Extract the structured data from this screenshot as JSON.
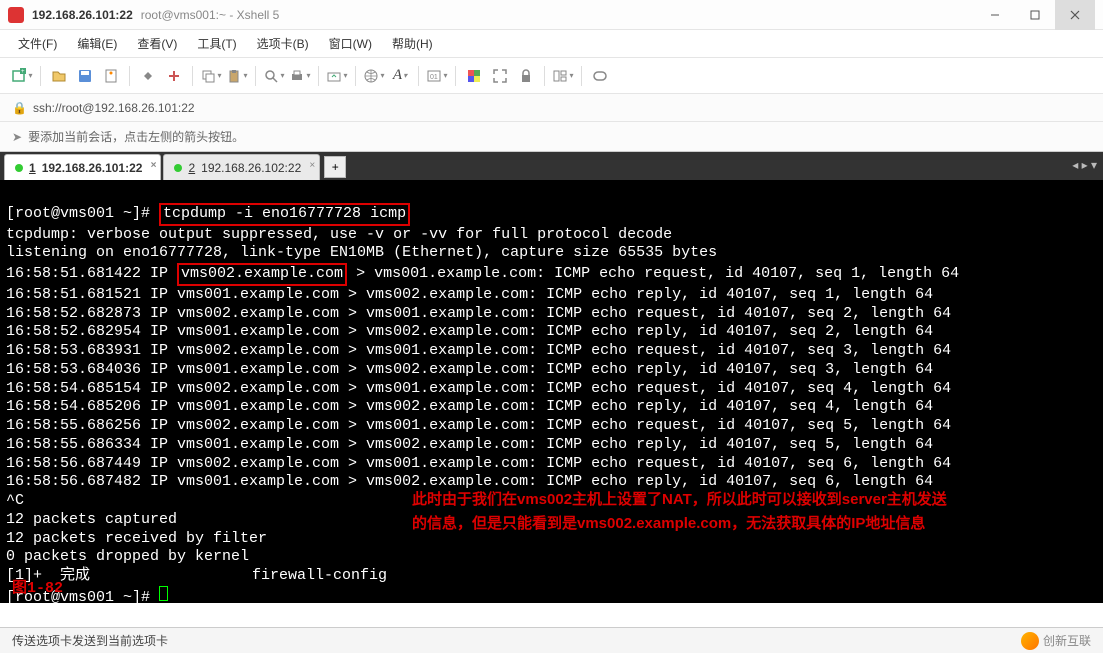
{
  "window": {
    "title_main": "192.168.26.101:22",
    "title_sub": "root@vms001:~ - Xshell 5"
  },
  "menubar": {
    "file": "文件(F)",
    "edit": "编辑(E)",
    "view": "查看(V)",
    "tools": "工具(T)",
    "tabs": "选项卡(B)",
    "window": "窗口(W)",
    "help": "帮助(H)"
  },
  "address": {
    "url": "ssh://root@192.168.26.101:22"
  },
  "infobar": {
    "text": "要添加当前会话，点击左侧的箭头按钮。"
  },
  "tabs": [
    {
      "num": "1",
      "label": "192.168.26.101:22",
      "active": true
    },
    {
      "num": "2",
      "label": "192.168.26.102:22",
      "active": false
    }
  ],
  "terminal": {
    "prompt1": "[root@vms001 ~]# ",
    "cmd": "tcpdump -i eno16777728 icmp",
    "line_suppressed": "tcpdump: verbose output suppressed, use -v or -vv for full protocol decode",
    "line_listening": "listening on eno16777728, link-type EN10MB (Ethernet), capture size 65535 bytes",
    "pkt_prefix_time": "16:58:51.681422 IP ",
    "pkt_host_boxed": "vms002.example.com",
    "pkt_suffix_1": " > vms001.example.com: ICMP echo request, id 40107, seq 1, length 64",
    "packets": [
      "16:58:51.681521 IP vms001.example.com > vms002.example.com: ICMP echo reply, id 40107, seq 1, length 64",
      "16:58:52.682873 IP vms002.example.com > vms001.example.com: ICMP echo request, id 40107, seq 2, length 64",
      "16:58:52.682954 IP vms001.example.com > vms002.example.com: ICMP echo reply, id 40107, seq 2, length 64",
      "16:58:53.683931 IP vms002.example.com > vms001.example.com: ICMP echo request, id 40107, seq 3, length 64",
      "16:58:53.684036 IP vms001.example.com > vms002.example.com: ICMP echo reply, id 40107, seq 3, length 64",
      "16:58:54.685154 IP vms002.example.com > vms001.example.com: ICMP echo request, id 40107, seq 4, length 64",
      "16:58:54.685206 IP vms001.example.com > vms002.example.com: ICMP echo reply, id 40107, seq 4, length 64",
      "16:58:55.686256 IP vms002.example.com > vms001.example.com: ICMP echo request, id 40107, seq 5, length 64",
      "16:58:55.686334 IP vms001.example.com > vms002.example.com: ICMP echo reply, id 40107, seq 5, length 64",
      "16:58:56.687449 IP vms002.example.com > vms001.example.com: ICMP echo request, id 40107, seq 6, length 64",
      "16:58:56.687482 IP vms001.example.com > vms002.example.com: ICMP echo reply, id 40107, seq 6, length 64"
    ],
    "ctrlc": "^C",
    "summary1": "12 packets captured",
    "summary2": "12 packets received by filter",
    "summary3": "0 packets dropped by kernel",
    "job": "[1]+  完成                  firewall-config",
    "prompt2": "[root@vms001 ~]# ",
    "annotation_line1": "此时由于我们在vms002主机上设置了NAT，所以此时可以接收到server主机发送",
    "annotation_line2": "的信息，但是只能看到是vms002.example.com，无法获取具体的IP地址信息",
    "figure_label": "图1-82"
  },
  "statusbar": {
    "text": "传送选项卡发送到当前选项卡",
    "brand": "创新互联"
  }
}
